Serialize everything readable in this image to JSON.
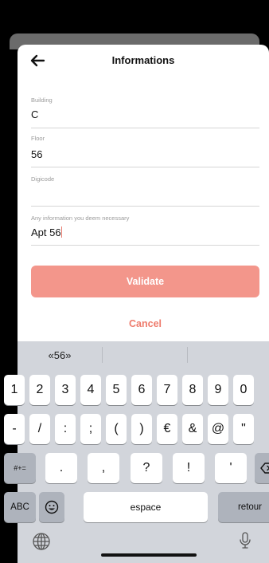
{
  "header": {
    "title": "Informations",
    "back_icon": "arrow-left-icon"
  },
  "form": {
    "fields": [
      {
        "label": "Building",
        "value": "C"
      },
      {
        "label": "Floor",
        "value": "56"
      },
      {
        "label": "Digicode",
        "value": ""
      },
      {
        "label": "Any information you deem necessary",
        "value": "Apt 56"
      }
    ],
    "validate_label": "Validate",
    "cancel_label": "Cancel"
  },
  "colors": {
    "accent": "#ee7b6c",
    "validate_bg": "#f3968b",
    "keyboard_bg": "#d2d5db"
  },
  "keyboard": {
    "suggestions": [
      "«56»",
      "",
      ""
    ],
    "row1": [
      "1",
      "2",
      "3",
      "4",
      "5",
      "6",
      "7",
      "8",
      "9",
      "0"
    ],
    "row2": [
      "-",
      "/",
      ":",
      ";",
      "(",
      ")",
      "€",
      "&",
      "@",
      "\""
    ],
    "row3": {
      "shift": "#+=",
      "keys": [
        ".",
        ",",
        "?",
        "!",
        "'"
      ],
      "backspace_icon": "backspace-icon"
    },
    "row4": {
      "abc": "ABC",
      "emoji_icon": "emoji-icon",
      "space": "espace",
      "return": "retour"
    },
    "globe_icon": "globe-icon",
    "mic_icon": "microphone-icon"
  }
}
